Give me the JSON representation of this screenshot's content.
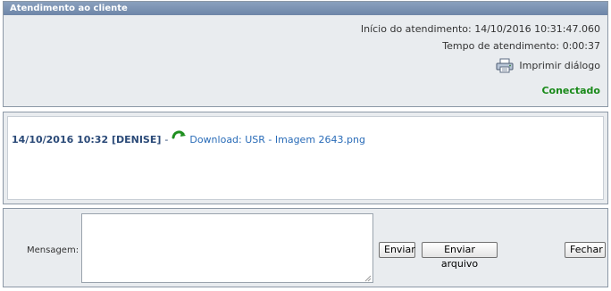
{
  "header": {
    "title": "Atendimento ao cliente"
  },
  "session": {
    "start_label": "Início do atendimento: 14/10/2016 10:31:47.060",
    "duration_label": "Tempo de atendimento: 0:00:37",
    "print_label": "Imprimir diálogo",
    "status": "Conectado"
  },
  "chat": {
    "messages": [
      {
        "meta": "14/10/2016 10:32 [DENISE]",
        "separator": "-",
        "link_text": "Download: USR - Imagem 2643.png"
      }
    ]
  },
  "composer": {
    "label": "Mensagem:",
    "value": "",
    "send_label": "Enviar",
    "send_file_label": "Enviar arquivo",
    "close_label": "Fechar"
  },
  "colors": {
    "header_bg": "#7a90b2",
    "panel_bg": "#e9ecef",
    "status_green": "#1a8a1a",
    "link_blue": "#2a6cb8"
  },
  "icons": {
    "print": "printer-icon",
    "download": "download-arrow-icon"
  }
}
